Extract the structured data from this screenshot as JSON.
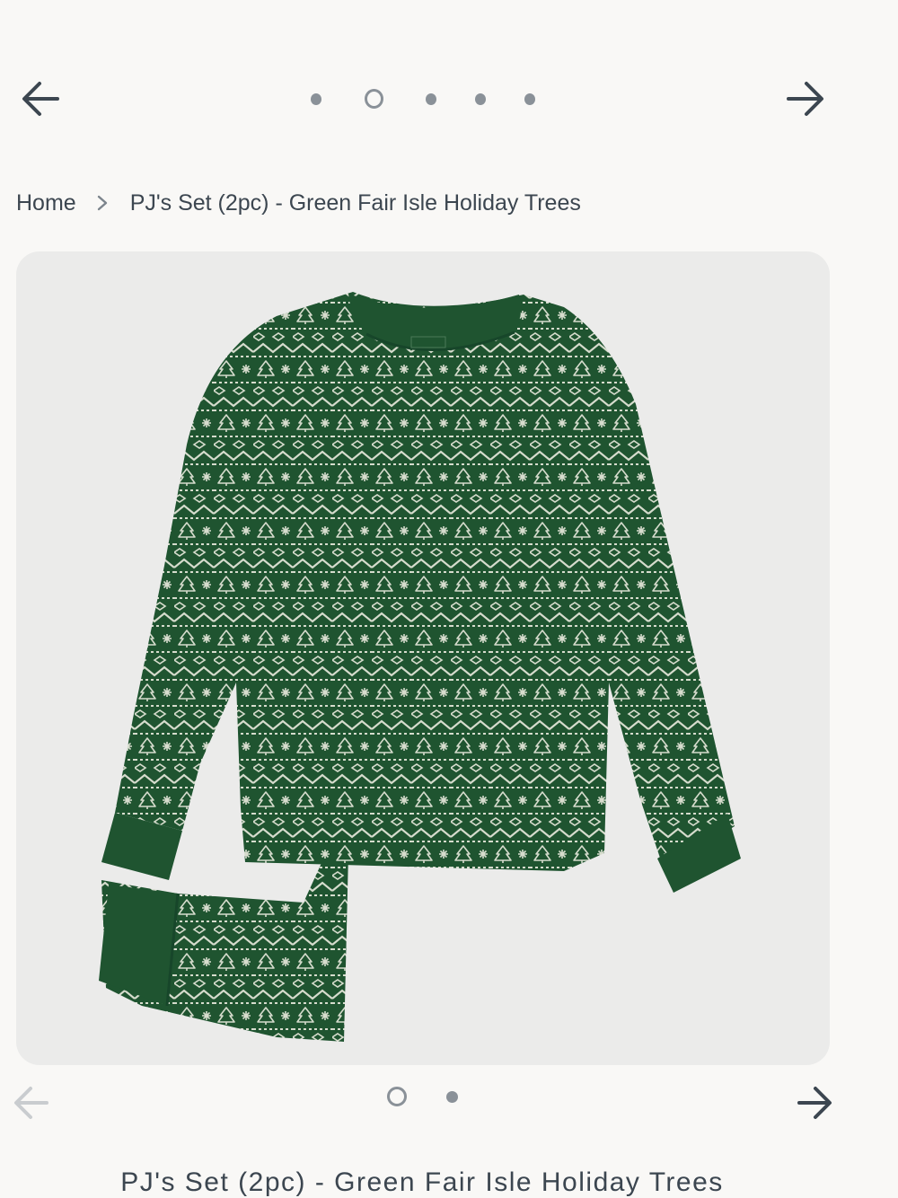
{
  "top_nav": {
    "prev_icon": "arrow-left-icon",
    "next_icon": "arrow-right-icon",
    "dots_total": 5,
    "active_dot": 1
  },
  "breadcrumb": {
    "home": "Home",
    "separator_icon": "chevron-right-icon",
    "current": "PJ's Set (2pc) - Green Fair Isle Holiday Trees"
  },
  "gallery": {
    "image_description": "pajama-set-image",
    "dots_total": 2,
    "active_dot": 0,
    "prev_icon": "arrow-left-icon",
    "next_icon": "arrow-right-icon"
  },
  "product": {
    "title": "PJ's Set (2pc) - Green Fair Isle Holiday Trees"
  },
  "colors": {
    "background": "#f9f8f6",
    "text": "#3c4650",
    "fabric_green": "#1f5430",
    "pattern_cream": "#d6dccd",
    "image_bg": "#ebebea"
  }
}
